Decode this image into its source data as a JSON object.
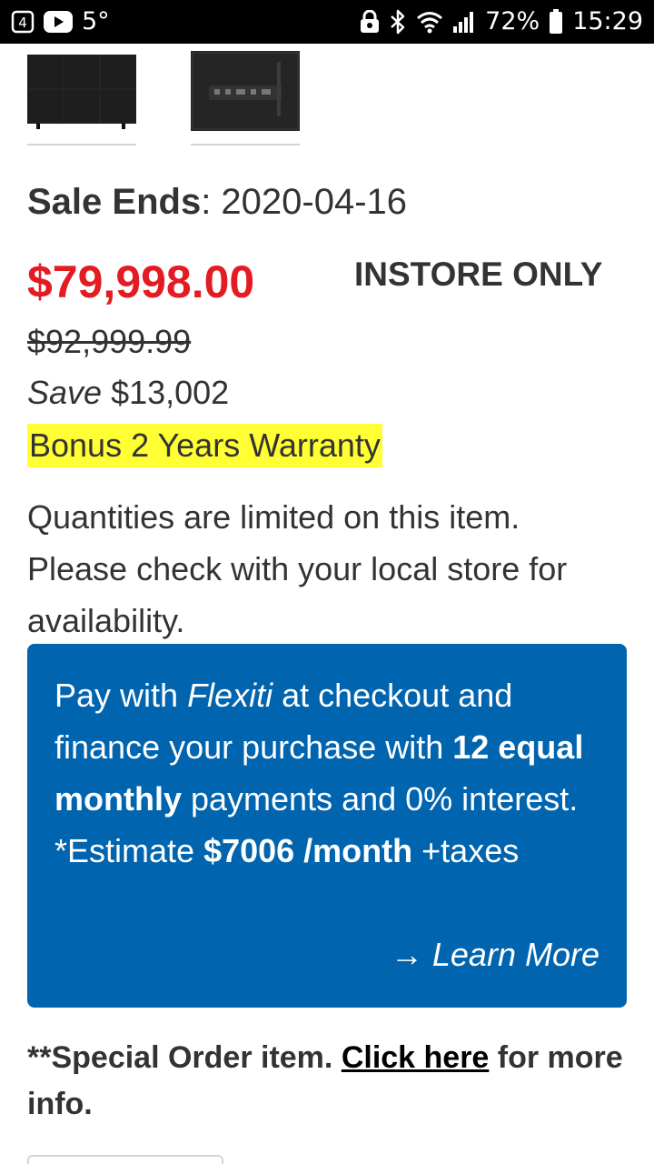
{
  "status_bar": {
    "temperature": "5°",
    "battery": "72%",
    "time": "15:29",
    "icons": [
      "notification-icon",
      "youtube-icon",
      "lock-icon",
      "bluetooth-icon",
      "wifi-icon",
      "signal-icon",
      "battery-icon"
    ]
  },
  "product": {
    "sale_ends_label": "Sale Ends",
    "sale_ends_date": ": 2020-04-16",
    "price": "$79,998.00",
    "availability": "INSTORE ONLY",
    "was_price": "$92,999.99",
    "save_word": "Save",
    "save_amount": " $13,002",
    "bonus": "Bonus 2 Years Warranty",
    "quantity_note": "Quantities are limited on this item. Please check with your local store for availability."
  },
  "financing": {
    "p1": "Pay with ",
    "brand": "Flexiti",
    "p2": " at checkout and finance your purchase with ",
    "b1": "12 equal monthly",
    "p3": " payments and 0% interest. *Estimate ",
    "b2": "$7006 /month",
    "p4": " +taxes",
    "learn_more": "→ Learn More"
  },
  "special_order": {
    "prefix": "**Special Order item. ",
    "link": "Click here",
    "suffix": " for more info."
  },
  "colors": {
    "price_red": "#e31b23",
    "flexiti_blue": "#0064ae",
    "highlight_yellow": "#ffff33"
  }
}
